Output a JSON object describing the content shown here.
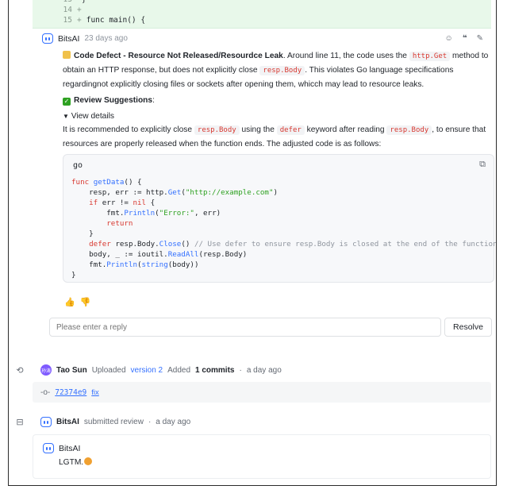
{
  "diff": {
    "lines": [
      {
        "num": "13",
        "prefix": "",
        "code": "}"
      },
      {
        "num": "14",
        "prefix": "+",
        "code": ""
      },
      {
        "num": "15",
        "prefix": "+",
        "code": "func main() {"
      }
    ]
  },
  "comment": {
    "author": "BitsAI",
    "time": "23 days ago",
    "issue_title": "Code Defect - Resource Not Released/Resourdce Leak",
    "issue_text_1": ". Around line 11, the code uses the ",
    "issue_code_1": "http.Get",
    "issue_text_2": " method to obtain an HTTP response, but does not explicitly close ",
    "issue_code_2": "resp.Body",
    "issue_text_3": ". This violates Go language specifications regardingnot explicitly closing files or sockets after opening them, whicch may lead to resource leaks.",
    "suggestions_title": "Review Suggestions",
    "suggestions_colon": ":",
    "view_details": "View details",
    "rec_text_1": "It is recommended to explicitly close ",
    "rec_code_1": "resp.Body",
    "rec_text_2": " using the ",
    "rec_code_2": "defer",
    "rec_text_3": " keyword after reading ",
    "rec_code_3": "resp.Body",
    "rec_text_4": ", to ensure that resources are properly released when the function ends. The adjusted code is as follows:",
    "code_lang": "go",
    "reply_placeholder": "Please enter a reply",
    "resolve_label": "Resolve"
  },
  "timeline": {
    "upload": {
      "user": "Tao Sun",
      "avatar_text": "孙涛",
      "text_1": "Uploaded",
      "version_link": "version 2",
      "text_2": "Added",
      "commits": "1 commits",
      "separator": "·",
      "time": "a day ago"
    },
    "commit": {
      "sha": "72374e9",
      "message": "fix"
    },
    "review": {
      "user": "BitsAI",
      "action": "submitted review",
      "separator": "·",
      "time": "a day ago",
      "card_author": "BitsAI",
      "card_text": "LGTM."
    }
  },
  "colors": {
    "accent": "#3370ff",
    "diff_bg": "#e8f8ea",
    "code_red": "#d83931"
  }
}
